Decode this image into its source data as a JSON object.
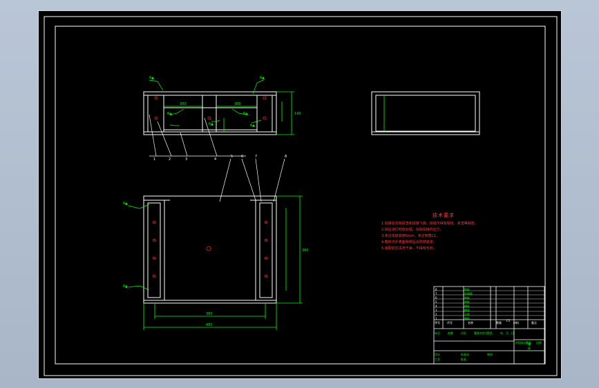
{
  "drawing": {
    "title_block": {
      "name": "箱体",
      "columns": [
        "序号",
        "代号",
        "名称",
        "数量",
        "材料",
        "备注"
      ],
      "parts": [
        {
          "no": "8",
          "name": "肋板"
        },
        {
          "no": "7",
          "name": "加强筋"
        },
        {
          "no": "6",
          "name": "侧板"
        },
        {
          "no": "5",
          "name": "底板"
        },
        {
          "no": "4",
          "name": "隔板"
        },
        {
          "no": "3",
          "name": "横梁"
        },
        {
          "no": "2",
          "name": "立柱"
        },
        {
          "no": "1",
          "name": "端板"
        }
      ],
      "rows_lower": [
        "标记",
        "处数",
        "分区",
        "更改文件号",
        "签名",
        "年、月、日"
      ],
      "rows_sign": [
        "设计",
        "标准化",
        "审核",
        "工艺",
        "批准"
      ],
      "stage_labels": [
        "阶段标记",
        "重量",
        "比例"
      ],
      "scale": "1:5"
    },
    "notes": {
      "title": "技术要求",
      "items": [
        "1.焊接后去除焊渣和焊接飞溅，焊缝不得有裂纹、夹渣等缺陷。",
        "2.焊后进行时效处理，消除焊接内应力。",
        "3.未注焊缝高度6mm，未注倒角C1。",
        "4.箱体内外表面除锈后涂防锈底漆。",
        "5.装配前应清洗干净，不得有毛刺。"
      ]
    },
    "balloons": [
      "1",
      "2",
      "3",
      "4",
      "5",
      "6",
      "7",
      "8"
    ],
    "weld_labels": [
      "6▲",
      "6▲",
      "6▲",
      "6▲",
      "6▲",
      "6▲",
      "6▲",
      "6▲"
    ],
    "dimensions": {
      "top_inner": "300",
      "top_mid": "300",
      "front_height": "140",
      "plan_inner": "380",
      "plan_outer": "480",
      "plan_height": "360"
    },
    "colors": {
      "frame": "#ffffff",
      "geometry": "#ffffff",
      "dimension": "#00ff00",
      "notes": "#ff3b3b",
      "leader": "#ffffff",
      "hole": "#ff2020"
    }
  }
}
